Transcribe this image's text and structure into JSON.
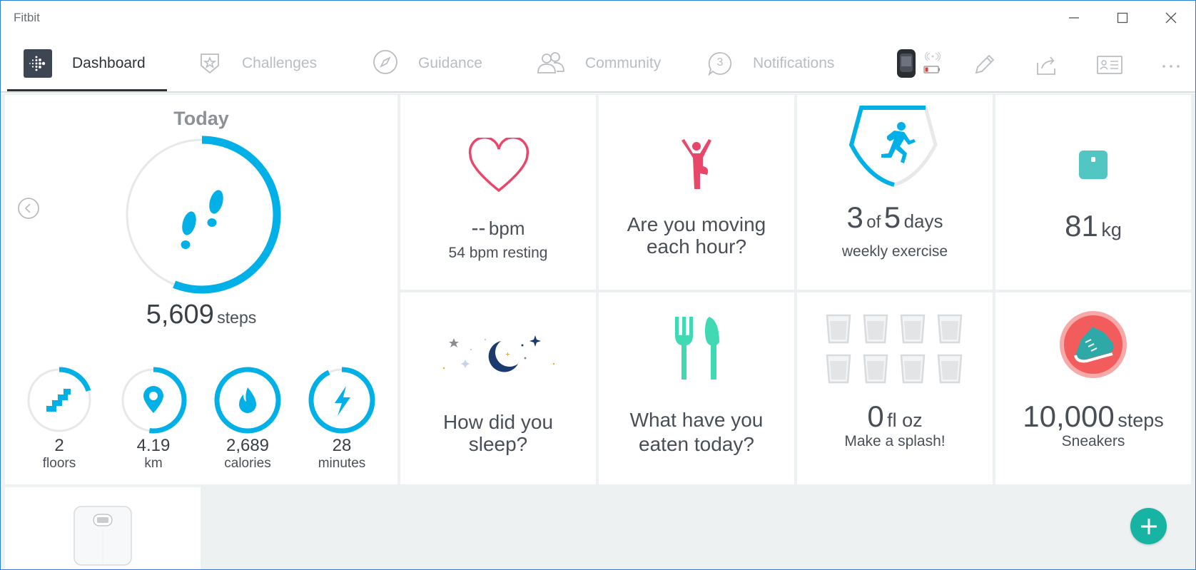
{
  "window": {
    "title": "Fitbit"
  },
  "nav": {
    "tabs": [
      {
        "label": "Dashboard",
        "icon": "fitbit-logo-icon",
        "active": true
      },
      {
        "label": "Challenges",
        "icon": "star-badge-icon"
      },
      {
        "label": "Guidance",
        "icon": "compass-icon"
      },
      {
        "label": "Community",
        "icon": "community-icon"
      },
      {
        "label": "Notifications",
        "icon": "notification-icon",
        "badge": "3"
      }
    ],
    "tools": [
      "device-icon",
      "edit-icon",
      "share-icon",
      "profile-card-icon",
      "more-icon"
    ]
  },
  "today": {
    "title": "Today",
    "steps_value": "5,609",
    "steps_unit": "steps",
    "steps_progress": 0.56,
    "stats": [
      {
        "value": "2",
        "unit": "floors",
        "icon": "stairs-icon",
        "progress": 0.2
      },
      {
        "value": "4.19",
        "unit": "km",
        "icon": "location-pin-icon",
        "progress": 0.52
      },
      {
        "value": "2,689",
        "unit": "calories",
        "icon": "flame-icon",
        "progress": 1.0
      },
      {
        "value": "28",
        "unit": "minutes",
        "icon": "lightning-icon",
        "progress": 0.93
      }
    ]
  },
  "cards": {
    "heart": {
      "value": "--",
      "unit": "bpm",
      "sub": "54 bpm resting"
    },
    "hourly": {
      "line1": "Are you moving",
      "line2": "each hour?"
    },
    "exercise": {
      "count": "3",
      "of": "of",
      "goal": "5",
      "unit": "days",
      "sub": "weekly exercise",
      "progress": 0.6
    },
    "weight": {
      "value": "81",
      "unit": "kg"
    },
    "sleep": {
      "line1": "How did you",
      "line2": "sleep?"
    },
    "food": {
      "line1": "What have you",
      "line2": "eaten today?"
    },
    "water": {
      "value": "0",
      "unit": "fl oz",
      "sub": "Make a splash!"
    },
    "badge": {
      "value": "10,000",
      "unit": "steps",
      "sub": "Sneakers"
    }
  },
  "colors": {
    "accent": "#00b0e6",
    "heart": "#e8476a",
    "food": "#3fd9b4",
    "weight": "#52c6c3",
    "sleep": "#1b3b6f",
    "fab": "#18b4a3",
    "badge": "#f25c5c"
  }
}
